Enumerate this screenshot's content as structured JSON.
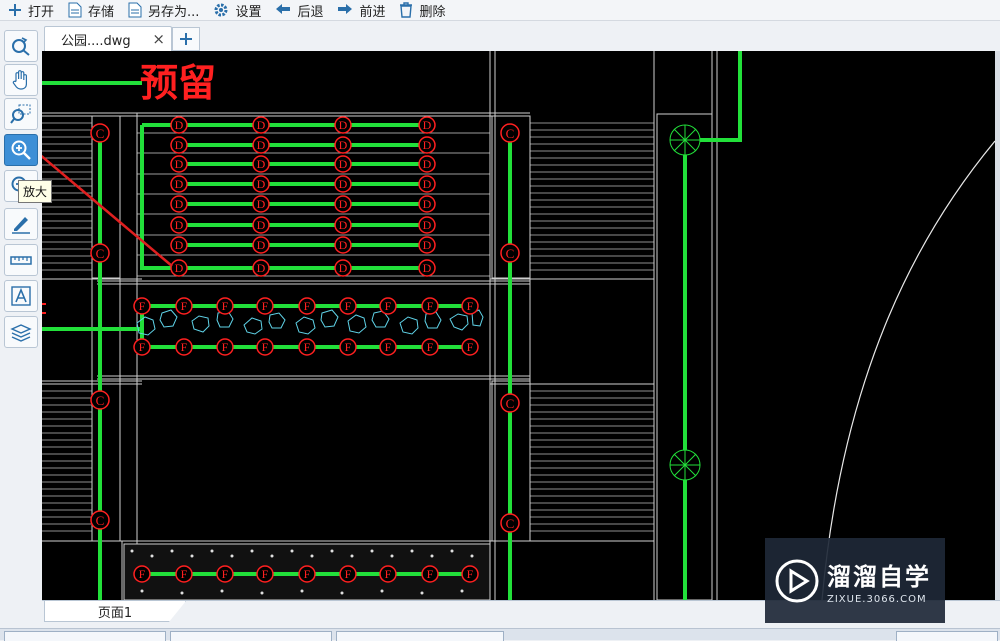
{
  "toolbar": {
    "open": "打开",
    "save": "存储",
    "save_as": "另存为...",
    "settings": "设置",
    "back": "后退",
    "forward": "前进",
    "delete": "删除"
  },
  "tabs": {
    "file": "公园....dwg",
    "close": "×",
    "add": "+"
  },
  "left_tools": {
    "tooltip": "放大",
    "items": [
      "zoom-prev",
      "pan",
      "zoom-window",
      "zoom-in",
      "zoom-out",
      "pen",
      "measure",
      "text",
      "layers"
    ]
  },
  "drawing": {
    "label_reserved": "预留",
    "symbols": {
      "c": "C",
      "d": "D",
      "f": "F"
    },
    "colors": {
      "background": "#000000",
      "pipe": "#22e03a",
      "text": "#ff2020",
      "arrow": "#e02020",
      "lines": "#ffffff"
    }
  },
  "page": {
    "tab": "页面1"
  },
  "watermark": {
    "title": "溜溜自学",
    "url": "ZIXUE.3066.COM"
  }
}
